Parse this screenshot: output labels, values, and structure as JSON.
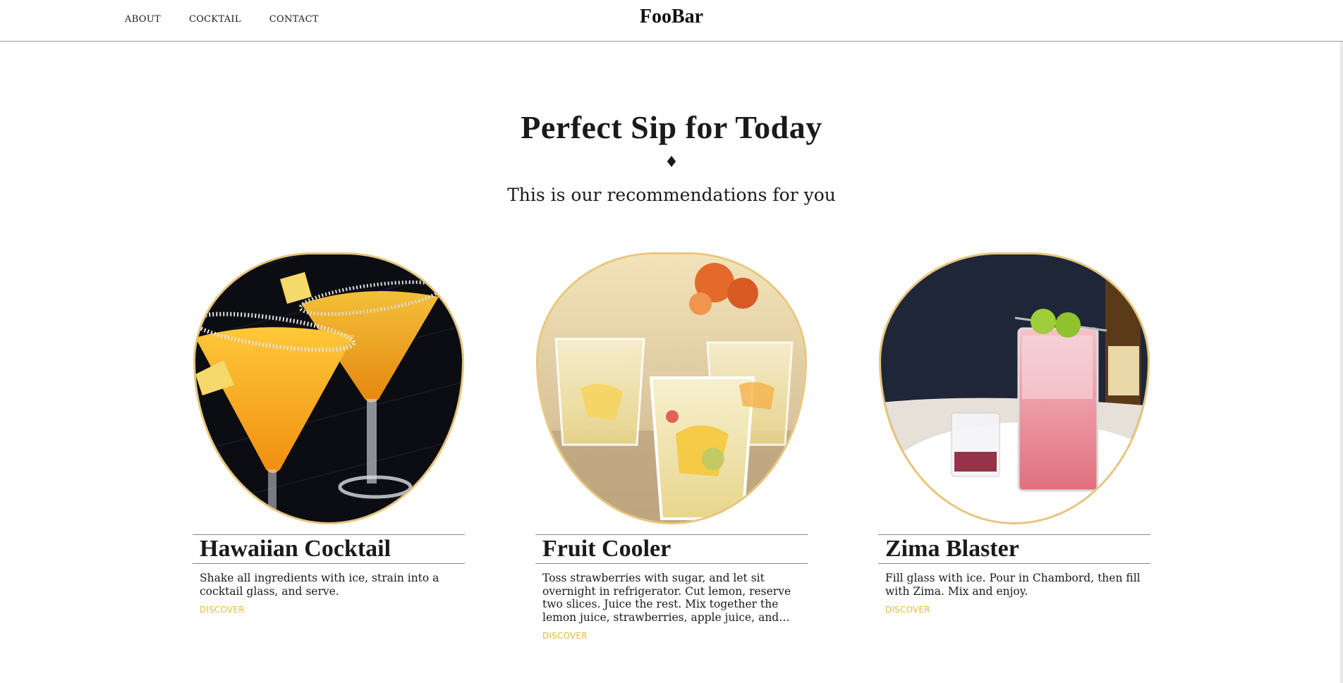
{
  "header": {
    "nav": [
      {
        "label": "ABOUT"
      },
      {
        "label": "COCKTAIL"
      },
      {
        "label": "CONTACT"
      }
    ],
    "brand": "FooBar"
  },
  "hero": {
    "title": "Perfect Sip for Today",
    "ornament": "♦",
    "subtitle": "This is our recommendations for you"
  },
  "cards": [
    {
      "title": "Hawaiian Cocktail",
      "description": "Shake all ingredients with ice, strain into a cocktail glass, and serve.",
      "link": "DISCOVER"
    },
    {
      "title": "Fruit Cooler",
      "description": "Toss strawberries with sugar, and let sit overnight in refrigerator. Cut lemon, reserve two slices. Juice the rest. Mix together the lemon juice, strawberries, apple juice, and so...",
      "link": "DISCOVER"
    },
    {
      "title": "Zima Blaster",
      "description": "Fill glass with ice. Pour in Chambord, then fill with Zima. Mix and enjoy.",
      "link": "DISCOVER"
    }
  ],
  "colors": {
    "accent": "#e8b93a",
    "frame": "#e8c67c",
    "text": "#1a1a1a"
  }
}
